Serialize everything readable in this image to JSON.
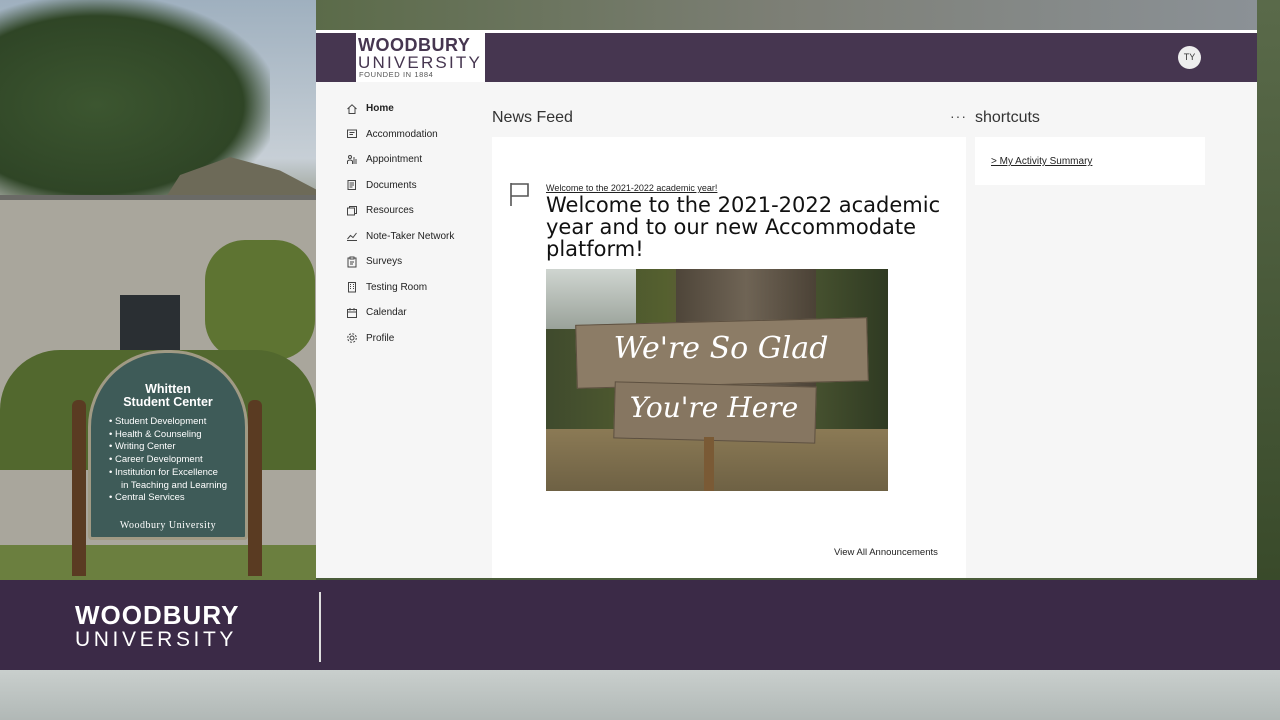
{
  "app": {
    "logo": {
      "line1": "WOODBURY",
      "line2": "UNIVERSITY",
      "line3": "FOUNDED IN 1884"
    },
    "user_initials": "TY"
  },
  "sidebar": {
    "items": [
      {
        "label": "Home",
        "icon": "home-icon",
        "active": true
      },
      {
        "label": "Accommodation",
        "icon": "message-icon"
      },
      {
        "label": "Appointment",
        "icon": "appointment-icon"
      },
      {
        "label": "Documents",
        "icon": "documents-icon"
      },
      {
        "label": "Resources",
        "icon": "resources-icon"
      },
      {
        "label": "Note-Taker Network",
        "icon": "chart-icon"
      },
      {
        "label": "Surveys",
        "icon": "clipboard-icon"
      },
      {
        "label": "Testing Room",
        "icon": "building-icon"
      },
      {
        "label": "Calendar",
        "icon": "calendar-icon"
      },
      {
        "label": "Profile",
        "icon": "gear-icon"
      }
    ]
  },
  "news_feed": {
    "title": "News Feed",
    "more": "···",
    "announcement": {
      "link_text": "Welcome to the 2021-2022 academic year!",
      "heading": "Welcome to the 2021-2022 academic year and to our new Accommodate platform!",
      "image_text_line1": "We're So Glad",
      "image_text_line2": "You're Here"
    },
    "view_all": "View All Announcements"
  },
  "shortcuts": {
    "title": "shortcuts",
    "items": [
      {
        "label": "> My Activity Summary"
      }
    ]
  },
  "background": {
    "sign": {
      "title_line1": "Whitten",
      "title_line2": "Student Center",
      "items": [
        "Student Development",
        "Health & Counseling",
        "Writing Center",
        "Career Development",
        "Institution for Excellence",
        "in Teaching and Learning",
        "Central Services"
      ],
      "footer": "Woodbury University"
    }
  },
  "banner": {
    "line1": "WOODBURY",
    "line2": "UNIVERSITY"
  },
  "colors": {
    "brand_purple": "#463650",
    "banner_purple": "#3b2a47",
    "panel_bg": "#f6f6f6"
  }
}
